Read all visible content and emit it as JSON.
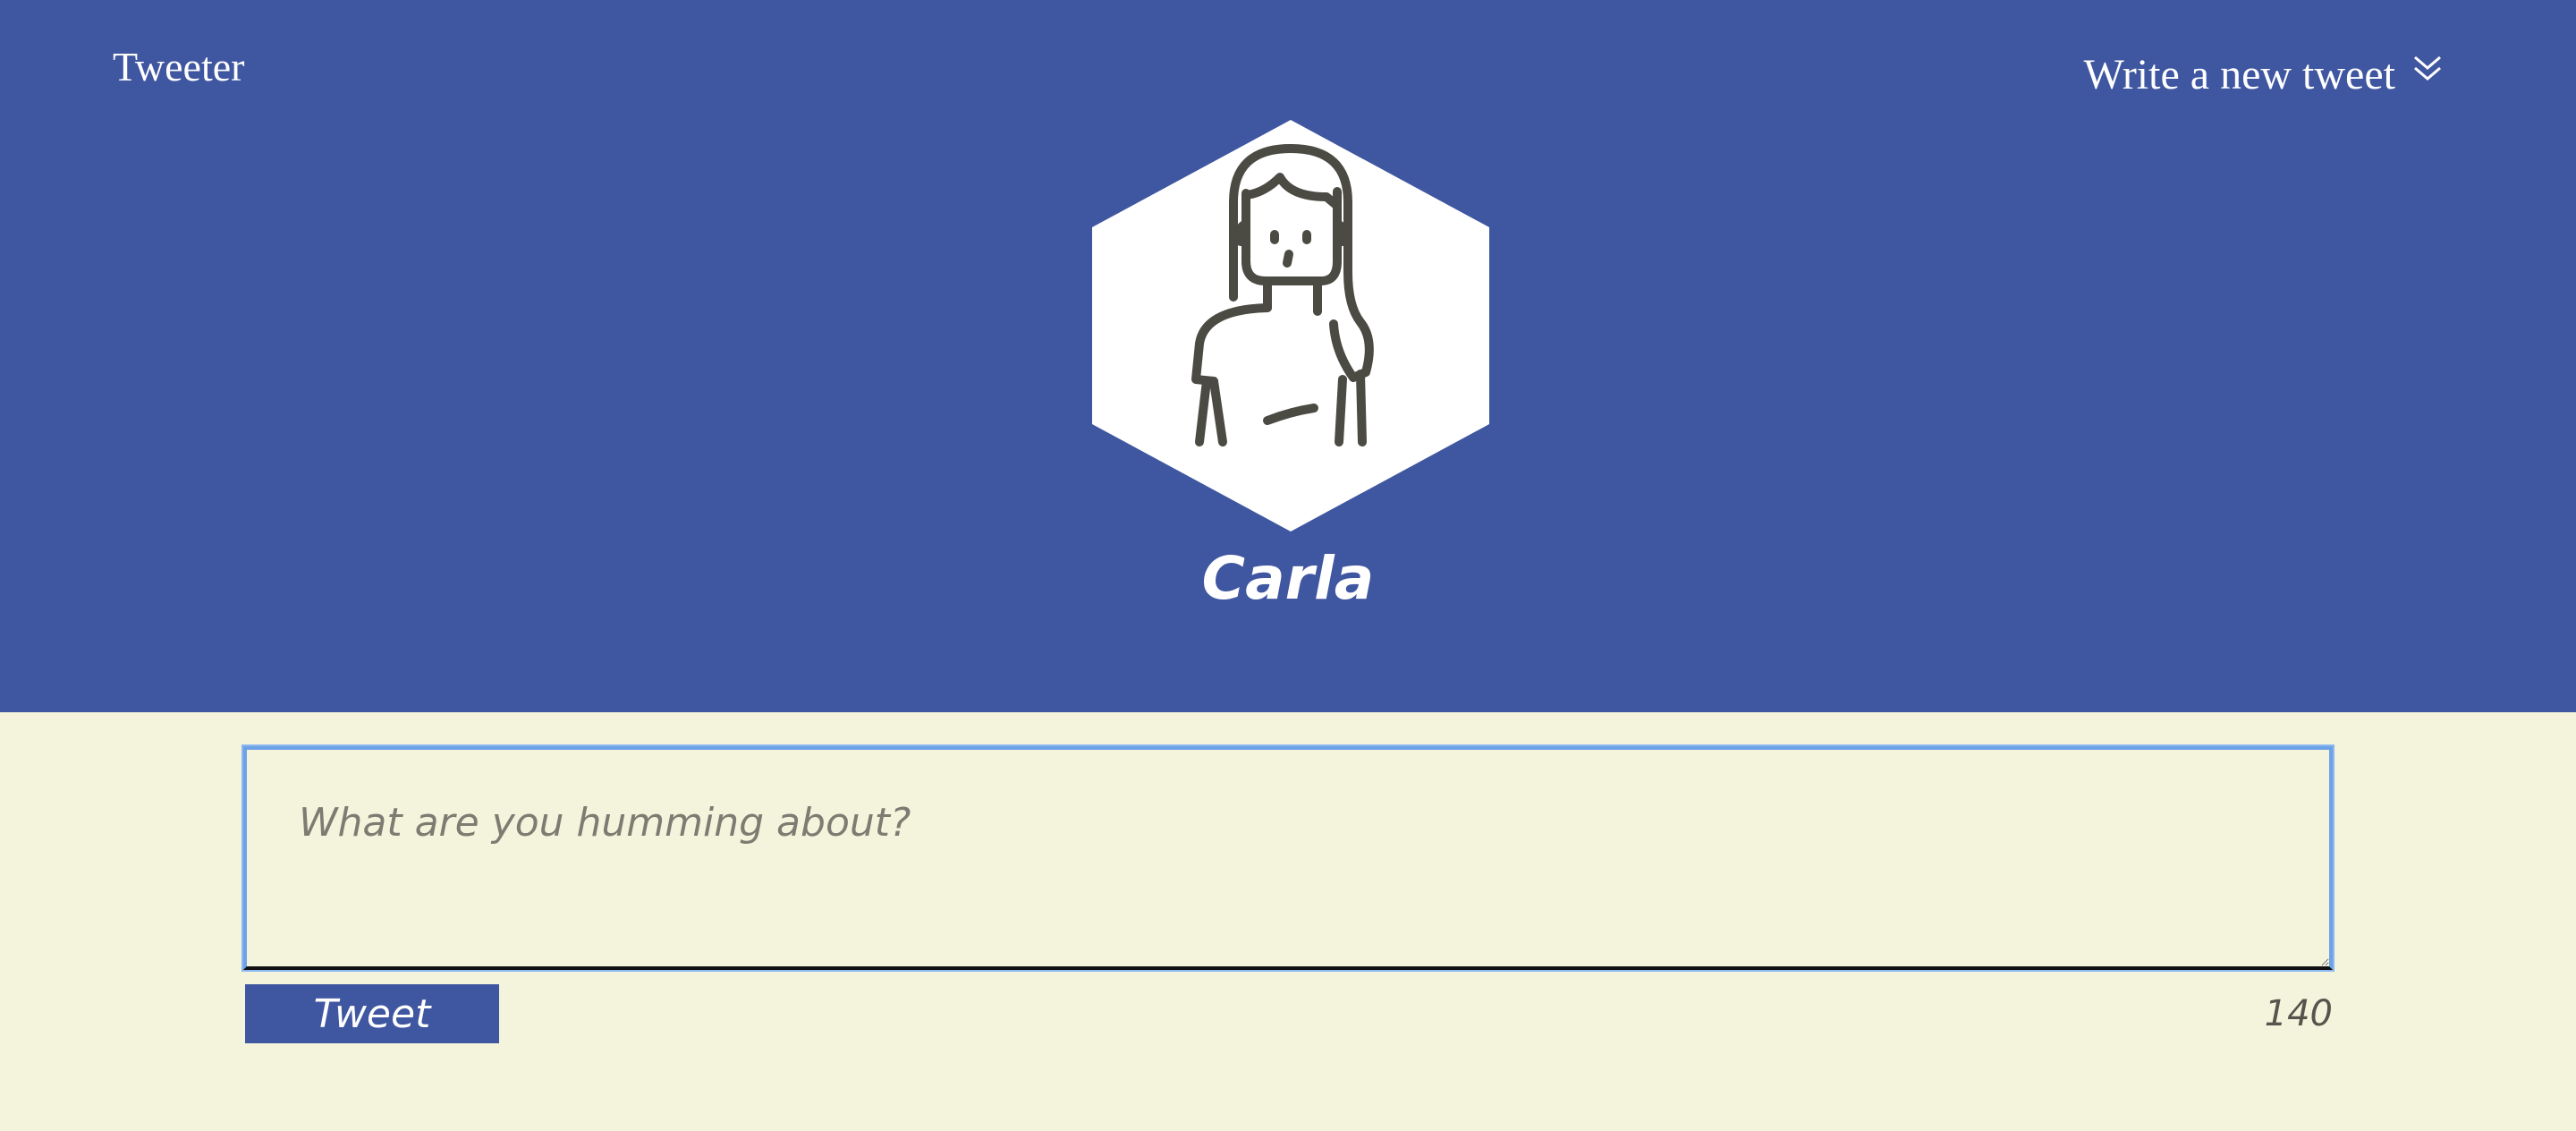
{
  "nav": {
    "brand": "Tweeter",
    "compose_toggle_label": "Write a new tweet",
    "compose_toggle_icon": "double-chevron-down-icon"
  },
  "profile": {
    "avatar_icon": "woman-avatar-icon",
    "name": "Carla"
  },
  "composer": {
    "placeholder": "What are you humming about?",
    "value": "",
    "submit_label": "Tweet",
    "char_count": "140"
  },
  "colors": {
    "header_bg": "#3f56a0",
    "page_bg": "#f4f4dc",
    "focus_ring": "#6ea2e6",
    "avatar_line": "#4b4a43"
  }
}
